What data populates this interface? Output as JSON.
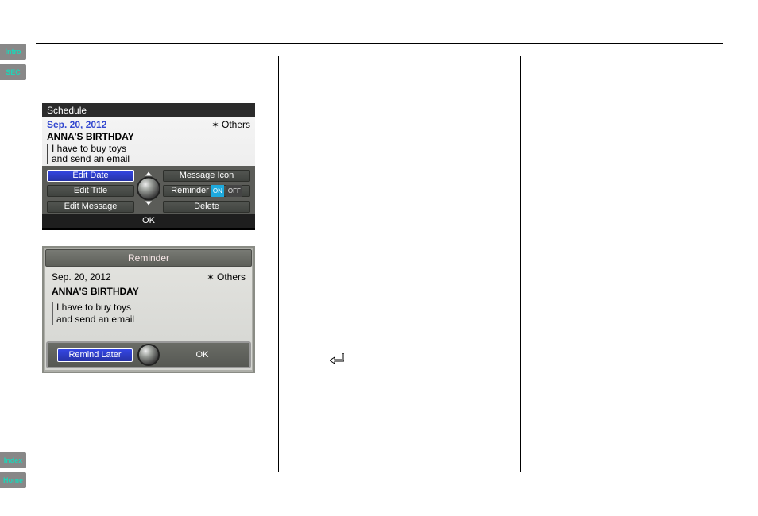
{
  "sidebar": {
    "top": [
      {
        "label": "Intro"
      },
      {
        "label": "SEC"
      }
    ],
    "bottom": [
      {
        "label": "Index"
      },
      {
        "label": "Home"
      }
    ]
  },
  "screenshot1": {
    "header": "Schedule",
    "date": "Sep. 20, 2012",
    "category": "Others",
    "title": "ANNA'S BIRTHDAY",
    "message_line1": "I have to buy toys",
    "message_line2": "and send an email",
    "menu": {
      "edit_date": "Edit Date",
      "message_icon": "Message Icon",
      "edit_title": "Edit Title",
      "reminder_label": "Reminder",
      "reminder_on": "ON",
      "reminder_off": "OFF",
      "edit_message": "Edit Message",
      "delete": "Delete"
    },
    "ok": "OK"
  },
  "screenshot2": {
    "header": "Reminder",
    "date": "Sep. 20, 2012",
    "category": "Others",
    "title": "ANNA'S BIRTHDAY",
    "message_line1": "I have to buy toys",
    "message_line2": "and send an email",
    "remind_later": "Remind Later",
    "ok": "OK"
  }
}
